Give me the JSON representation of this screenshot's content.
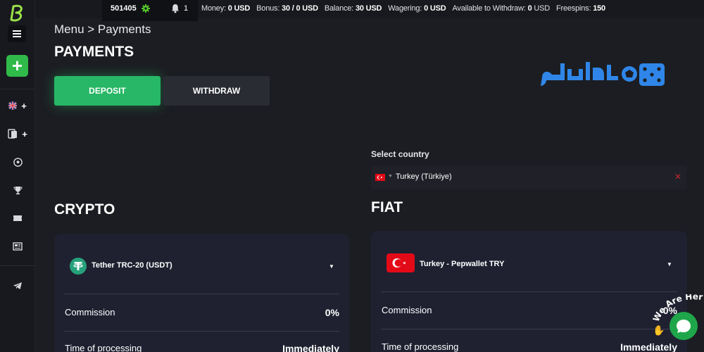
{
  "topbar": {
    "user_id": "501405",
    "notifications": "1",
    "stats": [
      {
        "label": "Money:",
        "value": "0 USD"
      },
      {
        "label": "Bonus:",
        "value": "30 / 0 USD"
      },
      {
        "label": "Balance:",
        "value": "30 USD"
      },
      {
        "label": "Wagering:",
        "value": "0 USD"
      },
      {
        "label": "Available to Withdraw:",
        "value": "0",
        "unit": "USD"
      },
      {
        "label": "Freespins:",
        "value": "150"
      }
    ]
  },
  "sidebar": {
    "icons": [
      "menu-icon",
      "plus-icon",
      "uk-flag-icon",
      "cards-icon",
      "soccer-ball-icon",
      "trophy-icon",
      "ticket-icon",
      "news-icon",
      "telegram-icon"
    ]
  },
  "page": {
    "breadcrumb": "Menu > Payments",
    "title": "PAYMENTS",
    "tabs": {
      "deposit": "DEPOSIT",
      "withdraw": "WITHDRAW"
    }
  },
  "country": {
    "label": "Select country",
    "selected": "Turkey (Türkiye)"
  },
  "crypto": {
    "title": "CRYPTO",
    "method": "Tether TRC-20 (USDT)",
    "rows": [
      {
        "label": "Commission",
        "value": "0%"
      },
      {
        "label": "Time of processing",
        "value": "Immediately"
      }
    ]
  },
  "fiat": {
    "title": "FIAT",
    "method": "Turkey - Pepwallet TRY",
    "rows": [
      {
        "label": "Commission",
        "value": "0%"
      },
      {
        "label": "Time of processing",
        "value": "Immediately"
      }
    ]
  },
  "chat": {
    "badge": "We Are Here!"
  },
  "colors": {
    "accent_green": "#28b766",
    "card_bg": "#1f2131",
    "page_bg": "#1c1d22"
  }
}
